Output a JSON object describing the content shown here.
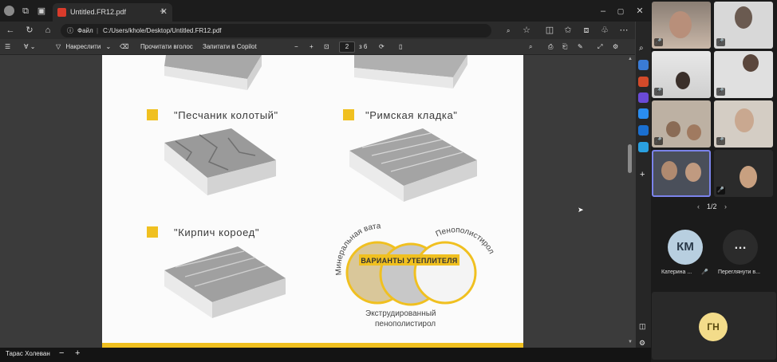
{
  "browser": {
    "tab_title": "Untitled.FR12.pdf",
    "address_label": "Файл",
    "address_path": "C:/Users/khole/Desktop/Untitled.FR12.pdf"
  },
  "pdf_toolbar": {
    "draw_label": "Накреслити",
    "read_aloud_label": "Прочитати вголос",
    "copilot_label": "Запитати в Copilot",
    "page_current": "2",
    "page_total": "з 6"
  },
  "pdf_page": {
    "items": [
      {
        "label": "\"Песчаник колотый\""
      },
      {
        "label": "\"Римская кладка\""
      },
      {
        "label": "\"Кирпич короед\""
      }
    ],
    "insulation": {
      "banner": "ВАРИАНТЫ УТЕПЛИТЕЛЯ",
      "left_label": "Минеральная вата",
      "right_label": "Пенополистирол",
      "bottom_label_1": "Экструдированный",
      "bottom_label_2": "пенополистирол"
    }
  },
  "bottom_bar": {
    "presenter_name": "Тарас Холеван"
  },
  "teams": {
    "pager": "1/2",
    "participants": [
      {
        "initials": "КМ",
        "name": "Катерина ..."
      },
      {
        "initials": "…",
        "name": "Переглянути в..."
      }
    ],
    "self_initials": "ГН"
  },
  "colors": {
    "accent_yellow": "#f0c020",
    "avatar_blue": "#b8cfe0",
    "avatar_gold": "#f3dc8a"
  }
}
